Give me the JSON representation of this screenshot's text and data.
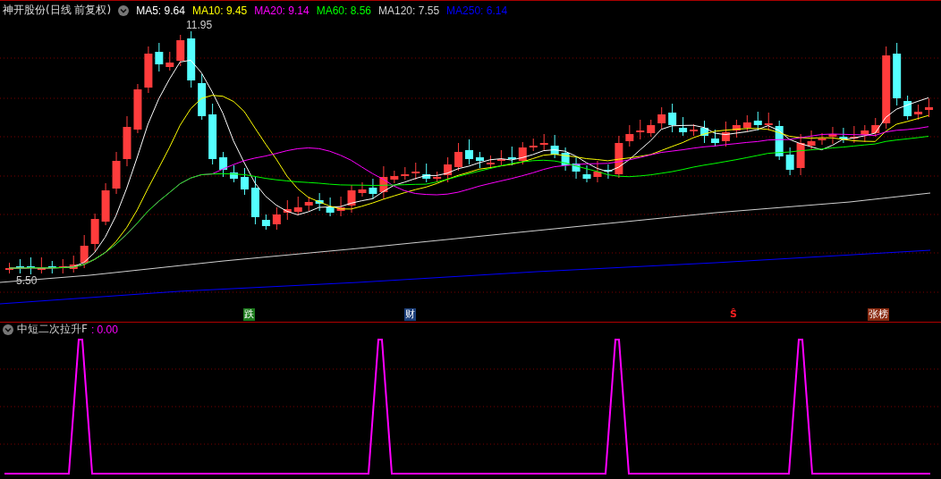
{
  "header": {
    "title": "神开股份(日线 前复权)",
    "averages": [
      {
        "label": "MA5: 9.64",
        "color": "#ffffff"
      },
      {
        "label": "MA10: 9.45",
        "color": "#ffff00"
      },
      {
        "label": "MA20: 9.14",
        "color": "#ff00ff"
      },
      {
        "label": "MA60: 8.56",
        "color": "#00ff00"
      },
      {
        "label": "MA120: 7.55",
        "color": "#d0d0d0"
      },
      {
        "label": "MA250: 6.14",
        "color": "#0000ff"
      }
    ]
  },
  "chart": {
    "high_label": "11.95",
    "low_label": "5.50"
  },
  "markers": [
    {
      "kind": "tag",
      "text": "跌",
      "color": "#1c7a1c"
    },
    {
      "kind": "tag",
      "text": "财",
      "color": "#1c3f7a"
    },
    {
      "kind": "plain",
      "text": "Ŝ",
      "color": "#ff2020"
    },
    {
      "kind": "tag",
      "text": "张榜",
      "color": "#8a2a10"
    }
  ],
  "indicator": {
    "title": "中短二次拉升F",
    "value": ": 0.00"
  }
}
